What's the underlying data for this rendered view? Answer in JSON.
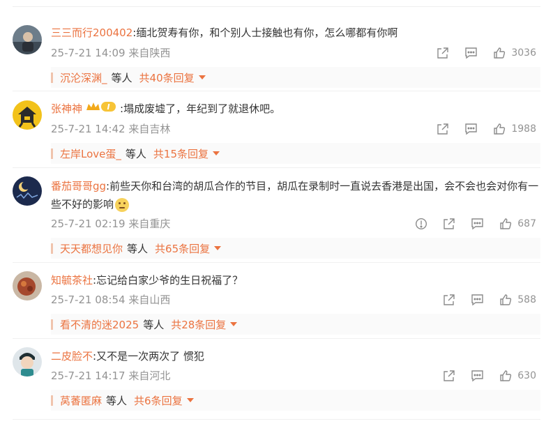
{
  "comments": [
    {
      "user": "三三而行200402",
      "text": ":缅北贺寿有你，和个别人士接触也有你，怎么哪都有你啊",
      "date": "25-7-21 14:09",
      "loc": "来自陕西",
      "likes": "3036",
      "reply_user": "沉沦深渊_",
      "reply_etc": "等人",
      "reply_total": "共40条回复",
      "avatar_icon": "avatar-dark-portrait"
    },
    {
      "user": "张神神",
      "text": ":塌成废墟了，年纪到了就退休吧。",
      "date": "25-7-21 14:42",
      "loc": "来自吉林",
      "likes": "1988",
      "reply_user": "左岸Love蛋_",
      "reply_etc": "等人",
      "reply_total": "共15条回复",
      "badge_text": "I",
      "avatar_icon": "avatar-house-logo"
    },
    {
      "user": "番茄哥哥gg",
      "text": ":前些天你和台湾的胡瓜合作的节目，胡瓜在录制时一直说去香港是出国，会不会也会对你有一些不好的影响",
      "date": "25-7-21 02:19",
      "loc": "来自重庆",
      "likes": "687",
      "reply_user": "天天都想见你",
      "reply_etc": "等人",
      "reply_total": "共65条回复",
      "avatar_icon": "avatar-night-moon"
    },
    {
      "user": "知毓茶社",
      "text": ":忘记给白家少爷的生日祝福了？",
      "date": "25-7-21 08:54",
      "loc": "来自山西",
      "likes": "588",
      "reply_user": "看不清的迷2025",
      "reply_etc": "等人",
      "reply_total": "共28条回复",
      "avatar_icon": "avatar-food-photo"
    },
    {
      "user": "二皮脸不",
      "text": ":又不是一次两次了 惯犯",
      "date": "25-7-21 14:17",
      "loc": "来自河北",
      "likes": "630",
      "reply_user": "莴萫匿麻",
      "reply_etc": "等人",
      "reply_total": "共6条回复",
      "avatar_icon": "avatar-cartoon-boy"
    }
  ],
  "colors": {
    "username": "#eb7340",
    "meta": "#939393",
    "text": "#333333",
    "reply_bg": "#fafafa"
  }
}
